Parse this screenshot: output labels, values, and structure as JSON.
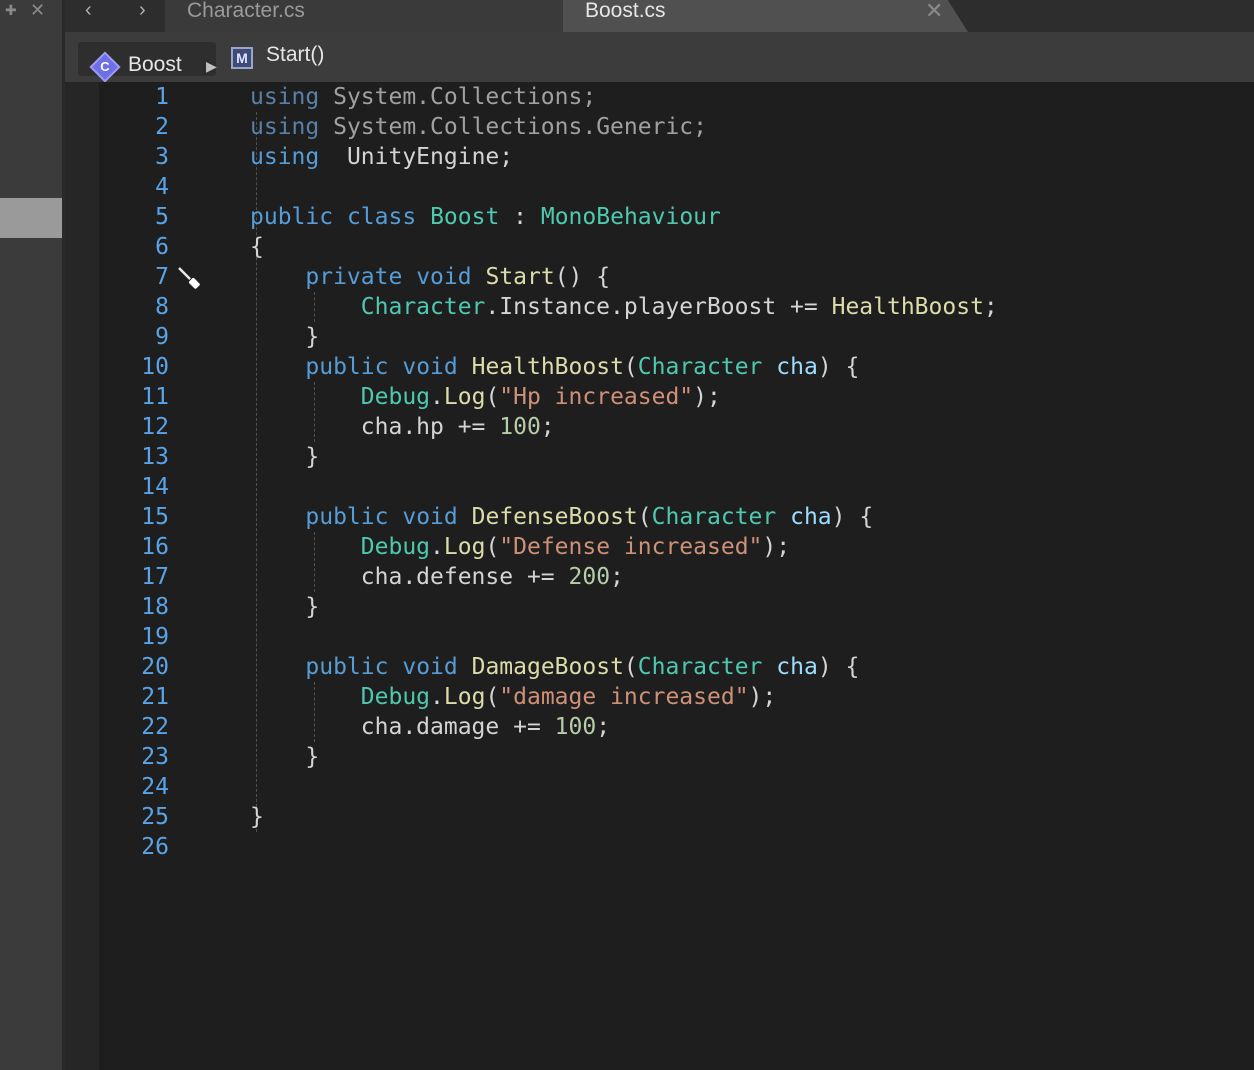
{
  "left_panel": {
    "pin_glyph": "✚",
    "close_glyph": "✕"
  },
  "tabbar": {
    "back_glyph": "‹",
    "forward_glyph": "›",
    "tabs": [
      {
        "label": "Character.cs",
        "active": false
      },
      {
        "label": "Boost.cs",
        "active": true
      }
    ],
    "close_glyph": "✕"
  },
  "breadcrumb": {
    "class_icon_letter": "C",
    "class_name": "Boost",
    "separator": "▶",
    "method_icon_letter": "M",
    "method_name": "Start()"
  },
  "colors": {
    "keyword": "#569cd6",
    "type": "#4ec9b0",
    "function": "#dcdcaa",
    "parameter": "#9cdcfe",
    "string": "#ce9178",
    "number": "#b5cea8",
    "line_number": "#5aa3e6"
  },
  "icons": {
    "cursor": "screwdriver-cursor-icon"
  },
  "editor": {
    "lines": [
      {
        "n": "1",
        "tokens": [
          [
            "kwd",
            "using"
          ],
          [
            "dim",
            " System.Collections;"
          ]
        ]
      },
      {
        "n": "2",
        "tokens": [
          [
            "kwd",
            "using"
          ],
          [
            "dim",
            " System.Collections.Generic;"
          ]
        ]
      },
      {
        "n": "3",
        "tokens": [
          [
            "kw",
            "using"
          ],
          [
            "",
            "  UnityEngine;"
          ]
        ]
      },
      {
        "n": "4",
        "tokens": []
      },
      {
        "n": "5",
        "tokens": [
          [
            "kw",
            "public"
          ],
          [
            "",
            " "
          ],
          [
            "kw",
            "class"
          ],
          [
            "",
            " "
          ],
          [
            "ty",
            "Boost"
          ],
          [
            "",
            " : "
          ],
          [
            "ty",
            "MonoBehaviour"
          ]
        ]
      },
      {
        "n": "6",
        "tokens": [
          [
            "",
            "{"
          ]
        ]
      },
      {
        "n": "7",
        "tokens": [
          [
            "",
            "    "
          ],
          [
            "kw",
            "private"
          ],
          [
            "",
            " "
          ],
          [
            "kw",
            "void"
          ],
          [
            "",
            " "
          ],
          [
            "fn",
            "Start"
          ],
          [
            "",
            "() {"
          ]
        ]
      },
      {
        "n": "8",
        "tokens": [
          [
            "",
            "        "
          ],
          [
            "ty",
            "Character"
          ],
          [
            "",
            ".Instance.playerBoost += "
          ],
          [
            "fn",
            "HealthBoost"
          ],
          [
            "",
            ";"
          ]
        ]
      },
      {
        "n": "9",
        "tokens": [
          [
            "",
            "    }"
          ]
        ]
      },
      {
        "n": "10",
        "tokens": [
          [
            "",
            "    "
          ],
          [
            "kw",
            "public"
          ],
          [
            "",
            " "
          ],
          [
            "kw",
            "void"
          ],
          [
            "",
            " "
          ],
          [
            "fn",
            "HealthBoost"
          ],
          [
            "",
            "("
          ],
          [
            "ty",
            "Character"
          ],
          [
            "",
            " "
          ],
          [
            "pa",
            "cha"
          ],
          [
            "",
            ") {"
          ]
        ]
      },
      {
        "n": "11",
        "tokens": [
          [
            "",
            "        "
          ],
          [
            "ty",
            "Debug"
          ],
          [
            "",
            "."
          ],
          [
            "fn",
            "Log"
          ],
          [
            "",
            "("
          ],
          [
            "st",
            "\"Hp increased\""
          ],
          [
            "",
            ");"
          ]
        ]
      },
      {
        "n": "12",
        "tokens": [
          [
            "",
            "        cha.hp += "
          ],
          [
            "nu",
            "100"
          ],
          [
            "",
            ";"
          ]
        ]
      },
      {
        "n": "13",
        "tokens": [
          [
            "",
            "    }"
          ]
        ]
      },
      {
        "n": "14",
        "tokens": []
      },
      {
        "n": "15",
        "tokens": [
          [
            "",
            "    "
          ],
          [
            "kw",
            "public"
          ],
          [
            "",
            " "
          ],
          [
            "kw",
            "void"
          ],
          [
            "",
            " "
          ],
          [
            "fn",
            "DefenseBoost"
          ],
          [
            "",
            "("
          ],
          [
            "ty",
            "Character"
          ],
          [
            "",
            " "
          ],
          [
            "pa",
            "cha"
          ],
          [
            "",
            ") {"
          ]
        ]
      },
      {
        "n": "16",
        "tokens": [
          [
            "",
            "        "
          ],
          [
            "ty",
            "Debug"
          ],
          [
            "",
            "."
          ],
          [
            "fn",
            "Log"
          ],
          [
            "",
            "("
          ],
          [
            "st",
            "\"Defense increased\""
          ],
          [
            "",
            ");"
          ]
        ]
      },
      {
        "n": "17",
        "tokens": [
          [
            "",
            "        cha.defense += "
          ],
          [
            "nu",
            "200"
          ],
          [
            "",
            ";"
          ]
        ]
      },
      {
        "n": "18",
        "tokens": [
          [
            "",
            "    }"
          ]
        ]
      },
      {
        "n": "19",
        "tokens": []
      },
      {
        "n": "20",
        "tokens": [
          [
            "",
            "    "
          ],
          [
            "kw",
            "public"
          ],
          [
            "",
            " "
          ],
          [
            "kw",
            "void"
          ],
          [
            "",
            " "
          ],
          [
            "fn",
            "DamageBoost"
          ],
          [
            "",
            "("
          ],
          [
            "ty",
            "Character"
          ],
          [
            "",
            " "
          ],
          [
            "pa",
            "cha"
          ],
          [
            "",
            ") {"
          ]
        ]
      },
      {
        "n": "21",
        "tokens": [
          [
            "",
            "        "
          ],
          [
            "ty",
            "Debug"
          ],
          [
            "",
            "."
          ],
          [
            "fn",
            "Log"
          ],
          [
            "",
            "("
          ],
          [
            "st",
            "\"damage increased\""
          ],
          [
            "",
            ");"
          ]
        ]
      },
      {
        "n": "22",
        "tokens": [
          [
            "",
            "        cha.damage += "
          ],
          [
            "nu",
            "100"
          ],
          [
            "",
            ";"
          ]
        ]
      },
      {
        "n": "23",
        "tokens": [
          [
            "",
            "    }"
          ]
        ]
      },
      {
        "n": "24",
        "tokens": []
      },
      {
        "n": "25",
        "tokens": [
          [
            "",
            "}"
          ]
        ]
      },
      {
        "n": "26",
        "tokens": []
      }
    ]
  }
}
